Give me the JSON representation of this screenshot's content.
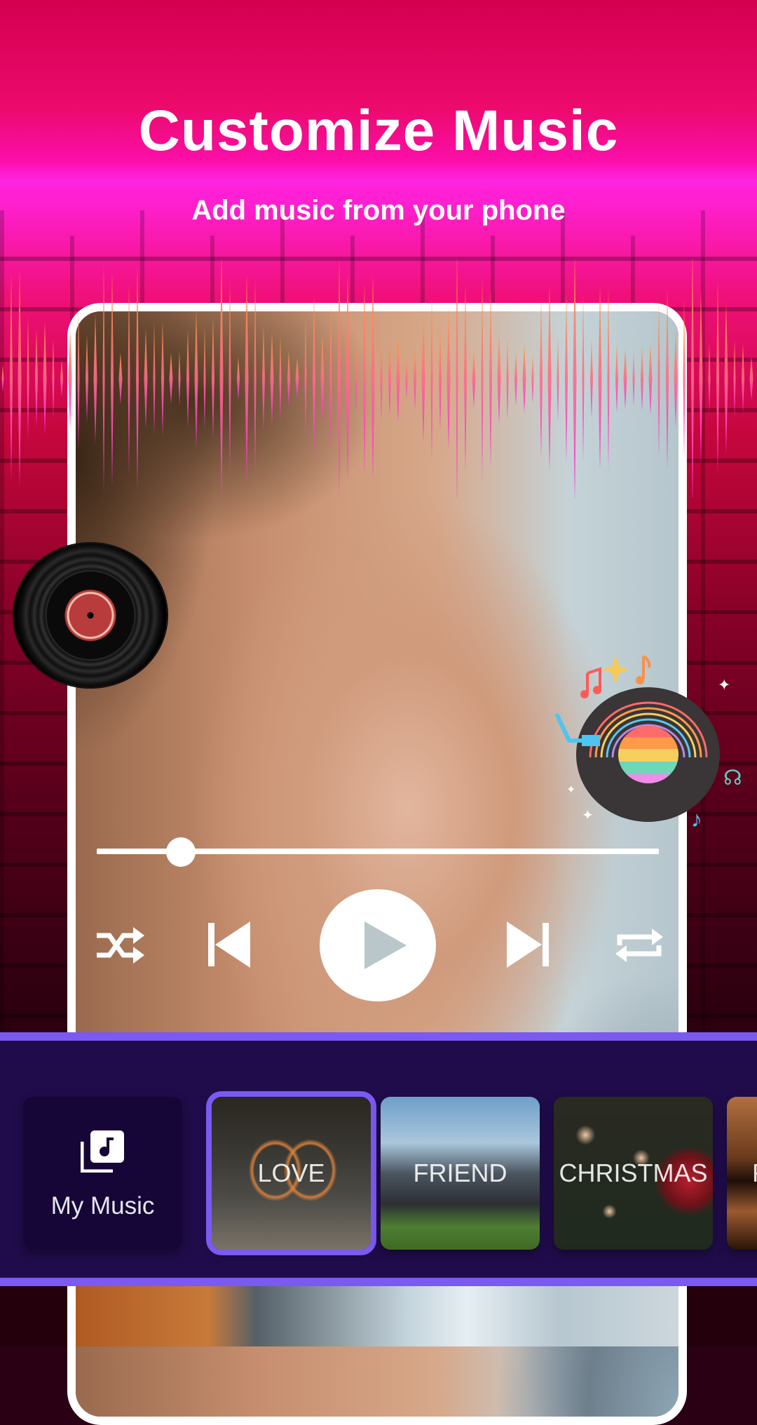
{
  "header": {
    "title": "Customize Music",
    "subtitle": "Add music from your phone"
  },
  "player": {
    "progress_fraction": 0.15,
    "controls": {
      "shuffle": "shuffle-icon",
      "previous": "skip-previous-icon",
      "play": "play-icon",
      "next": "skip-next-icon",
      "repeat": "repeat-icon"
    }
  },
  "decorations": {
    "left_record": "vinyl-record-icon",
    "right_record": "rainbow-turntable-icon"
  },
  "music_panel": {
    "my_music_label": "My Music",
    "my_music_icon": "music-library-icon",
    "categories": [
      {
        "label": "LOVE",
        "selected": true
      },
      {
        "label": "FRIEND",
        "selected": false
      },
      {
        "label": "CHRISTMAS",
        "selected": false
      },
      {
        "label": "F",
        "selected": false
      }
    ]
  },
  "colors": {
    "accent": "#7a5af0",
    "panel_bg": "#200c4a",
    "card_bg": "#150637",
    "neon_pink": "#ff10b8"
  }
}
